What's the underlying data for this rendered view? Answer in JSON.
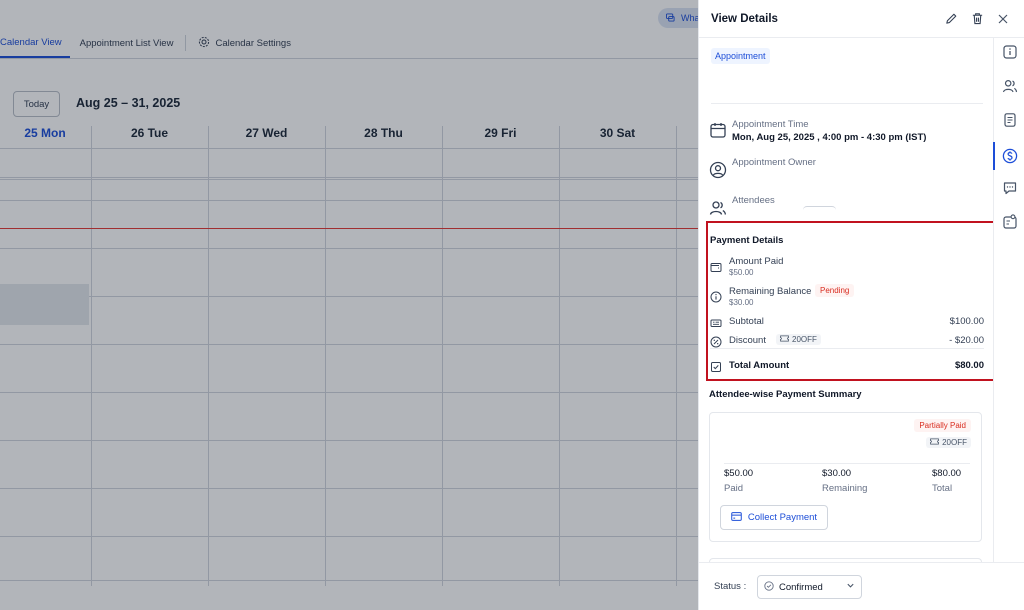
{
  "calendar": {
    "top_pill_label": "Wha",
    "tabs": [
      {
        "label": "Calendar View"
      },
      {
        "label": "Appointment List View"
      },
      {
        "label": "Calendar Settings"
      }
    ],
    "today_button": "Today",
    "date_range": "Aug 25 – 31, 2025",
    "days": [
      "25 Mon",
      "26 Tue",
      "27 Wed",
      "28 Thu",
      "29 Fri",
      "30 Sat"
    ]
  },
  "drawer": {
    "title": "View Details",
    "appointment_tag": "Appointment",
    "appointment_time": {
      "label": "Appointment Time",
      "value": "Mon, Aug 25, 2025 , 4:00 pm - 4:30 pm (IST)"
    },
    "appointment_owner": {
      "label": "Appointment Owner"
    },
    "attendees": {
      "label": "Attendees"
    },
    "payment": {
      "title": "Payment Details",
      "amount_paid": {
        "label": "Amount Paid",
        "value": "$50.00"
      },
      "remaining_balance": {
        "label": "Remaining Balance",
        "badge": "Pending",
        "value": "$30.00"
      },
      "subtotal": {
        "label": "Subtotal",
        "value": "$100.00"
      },
      "discount": {
        "label": "Discount",
        "coupon": "20OFF",
        "value": "- $20.00"
      },
      "total": {
        "label": "Total Amount",
        "value": "$80.00"
      }
    },
    "summary": {
      "title": "Attendee-wise Payment Summary",
      "badge": "Partially Paid",
      "coupon": "20OFF",
      "paid": {
        "amount": "$50.00",
        "caption": "Paid"
      },
      "remaining": {
        "amount": "$30.00",
        "caption": "Remaining"
      },
      "total": {
        "amount": "$80.00",
        "caption": "Total"
      },
      "collect_button": "Collect Payment"
    },
    "footer": {
      "status_label": "Status :",
      "status_value": "Confirmed"
    }
  },
  "colors": {
    "accent": "#1d4ed8",
    "highlight_border": "#c1121f",
    "pending": "#d92d20",
    "now_line": "#e53935"
  }
}
